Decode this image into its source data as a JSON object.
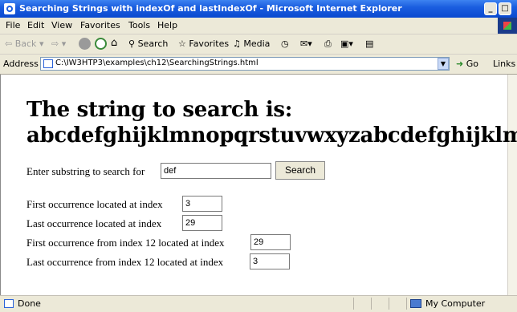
{
  "window": {
    "title": "Searching Strings with indexOf and lastIndexOf - Microsoft Internet Explorer",
    "minimize_glyph": "_",
    "maximize_glyph": "□"
  },
  "menu": {
    "items": [
      "File",
      "Edit",
      "View",
      "Favorites",
      "Tools",
      "Help"
    ]
  },
  "toolbar": {
    "back_label": "Back",
    "search_label": "Search",
    "favorites_label": "Favorites",
    "media_label": "Media"
  },
  "address": {
    "label": "Address",
    "url": "C:\\IW3HTP3\\examples\\ch12\\SearchingStrings.html",
    "go_label": "Go",
    "links_label": "Links"
  },
  "page": {
    "heading_line1": "The string to search is:",
    "heading_line2": "abcdefghijklmnopqrstuvwxyzabcdefghijklm",
    "search_prompt": "Enter substring to search for",
    "search_value": "def",
    "search_button": "Search",
    "results": [
      {
        "label": "First occurrence located at index",
        "value": "3"
      },
      {
        "label": "Last occurrence located at index",
        "value": "29"
      },
      {
        "label": "First occurrence from index 12 located at index",
        "value": "29"
      },
      {
        "label": "Last occurrence from index 12 located at index",
        "value": "3"
      }
    ]
  },
  "status": {
    "text": "Done",
    "zone": "My Computer"
  }
}
